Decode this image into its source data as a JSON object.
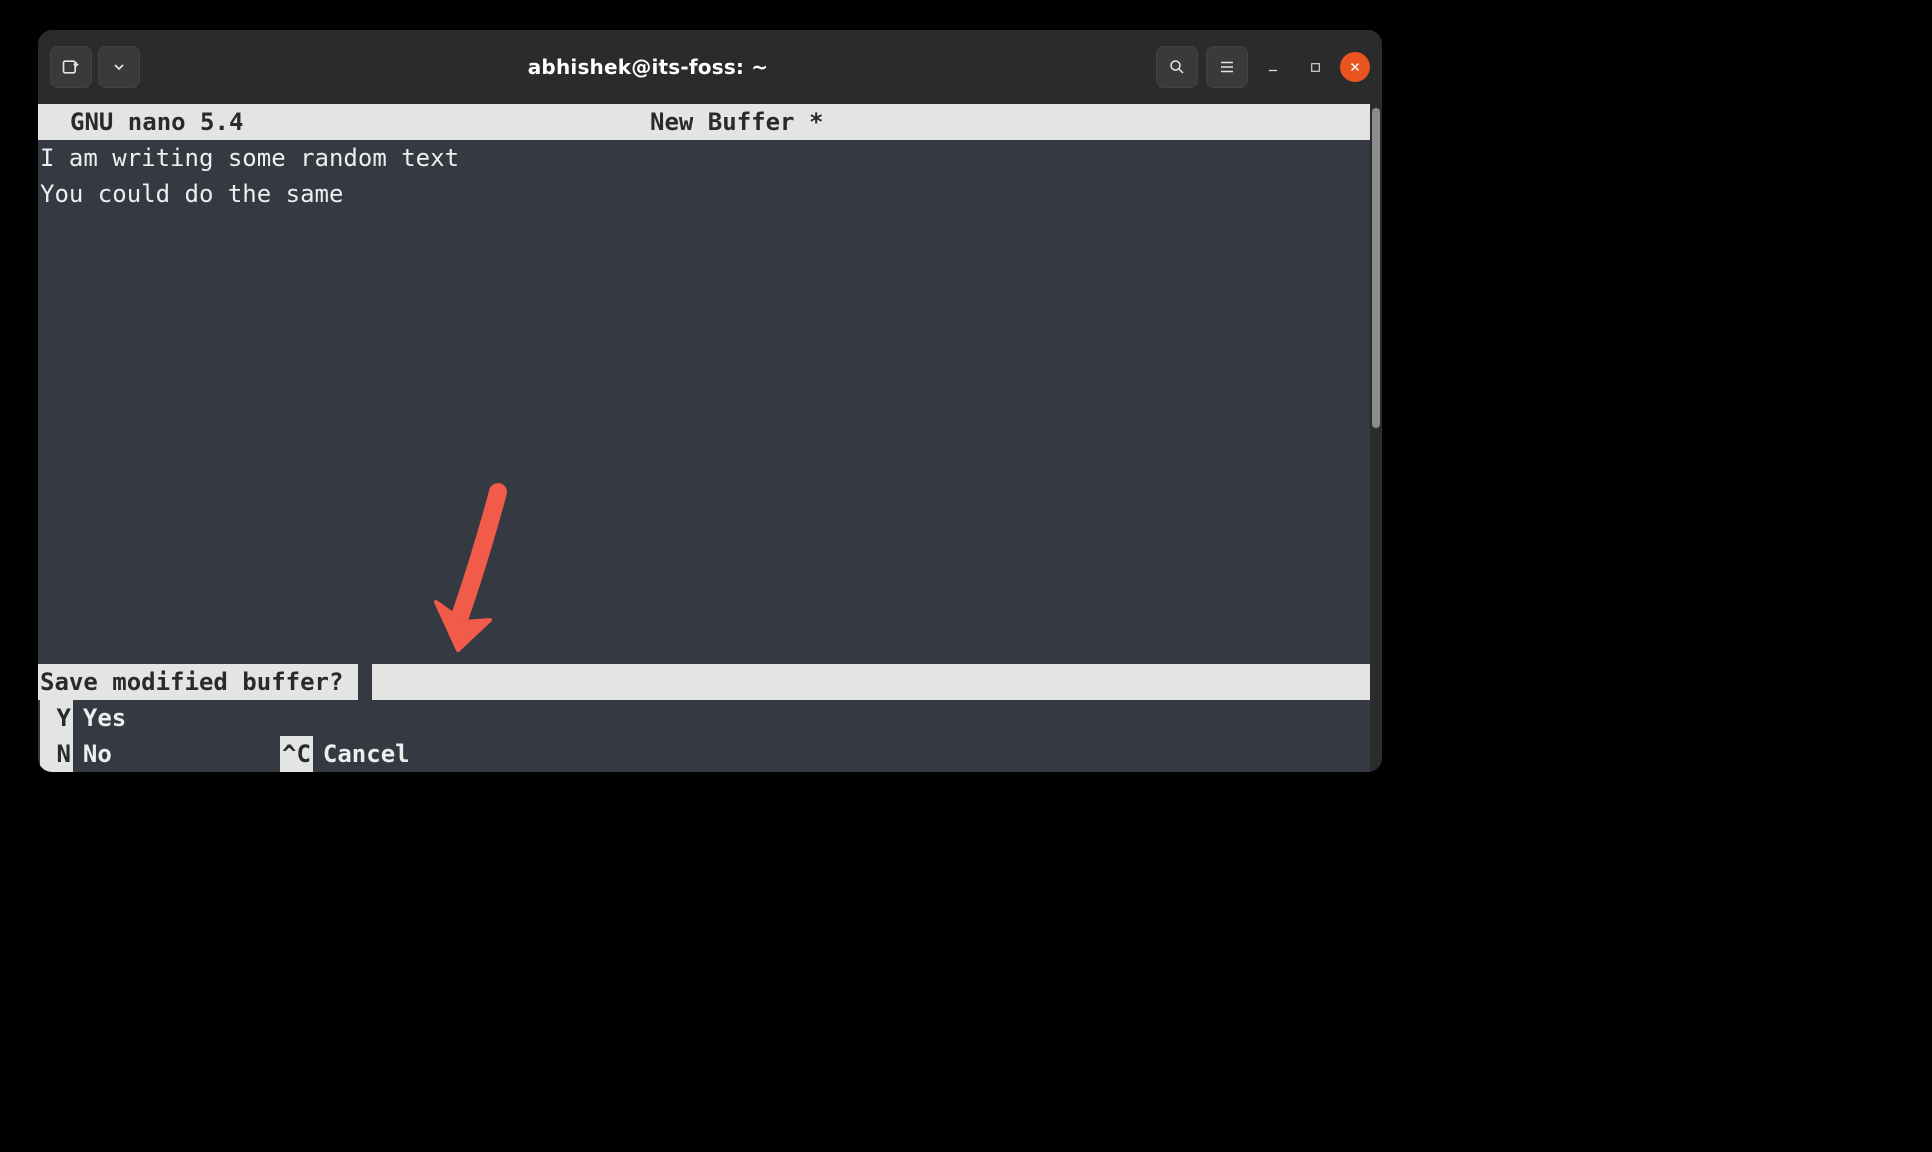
{
  "window": {
    "title": "abhishek@its-foss: ~"
  },
  "nano": {
    "header_left": "GNU nano 5.4",
    "header_center": "New Buffer *",
    "lines": [
      "I am writing some random text",
      "You could do the same"
    ],
    "prompt": "Save modified buffer? ",
    "options": [
      {
        "key": " Y",
        "label": "Yes"
      },
      {
        "key": " N",
        "label": "No"
      },
      {
        "key": "^C",
        "label": "Cancel"
      }
    ]
  }
}
